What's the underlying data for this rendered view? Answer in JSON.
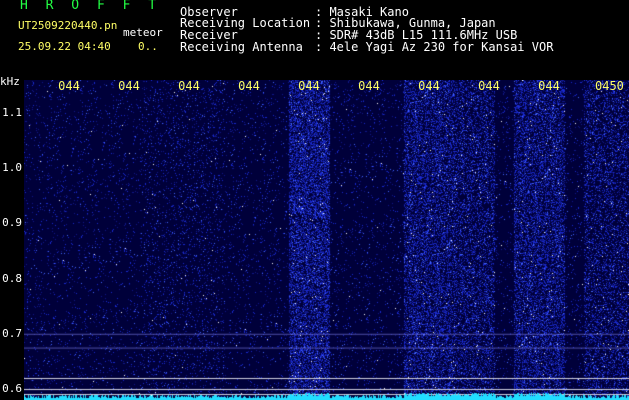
{
  "header": {
    "app_name": "H R O F F T",
    "file_name": "UT2509220440.pn",
    "meteor_label": "meteor",
    "date_time": "25.09.22 04:40",
    "count_value": "0..",
    "info": [
      {
        "label": "Observer",
        "value": ": Masaki Kano"
      },
      {
        "label": "Receiving Location",
        "value": ": Shibukawa, Gunma, Japan"
      },
      {
        "label": "Receiver",
        "value": ": SDR# 43dB L15 111.6MHz USB"
      },
      {
        "label": "Receiving Antenna",
        "value": ": 4ele Yagi Az 230 for Kansai VOR"
      }
    ]
  },
  "chart_data": {
    "type": "heatmap",
    "xlabel": "",
    "ylabel": "kHz",
    "x_ticks": [
      "044",
      "044",
      "044",
      "044",
      "044",
      "044",
      "044",
      "044",
      "044",
      "0450"
    ],
    "y_ticks": [
      "1.1",
      "1.0",
      "0.9",
      "0.8",
      "0.7",
      "0.6"
    ],
    "ylim": [
      0.58,
      1.16
    ],
    "bright_bands_minutes": [
      [
        4.46,
        4.47
      ],
      [
        4.48,
        4.49
      ],
      [
        4.49,
        4.495
      ],
      [
        4.455,
        4.457
      ]
    ],
    "carrier_lines_khz": [
      0.7,
      0.62,
      0.6,
      0.59
    ],
    "colors": {
      "background": "#00003a",
      "signal": "#2244ff",
      "hot": "#ffffff",
      "baseline": "#22ddff"
    }
  }
}
